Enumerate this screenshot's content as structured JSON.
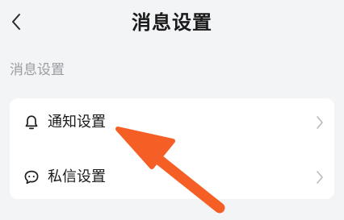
{
  "header": {
    "title": "消息设置",
    "back_icon": "chevron-left-icon"
  },
  "section": {
    "label": "消息设置"
  },
  "settings": {
    "items": [
      {
        "label": "通知设置",
        "icon": "bell-icon",
        "trailing_icon": "chevron-right-icon"
      },
      {
        "label": "私信设置",
        "icon": "chat-bubble-icon",
        "trailing_icon": "chevron-right-icon"
      }
    ]
  },
  "colors": {
    "background": "#f3f4f6",
    "card": "#ffffff",
    "text_primary": "#1a1a1a",
    "text_secondary": "#9a9ca1",
    "chevron": "#b8babe",
    "annotation_arrow": "#f55f25"
  }
}
